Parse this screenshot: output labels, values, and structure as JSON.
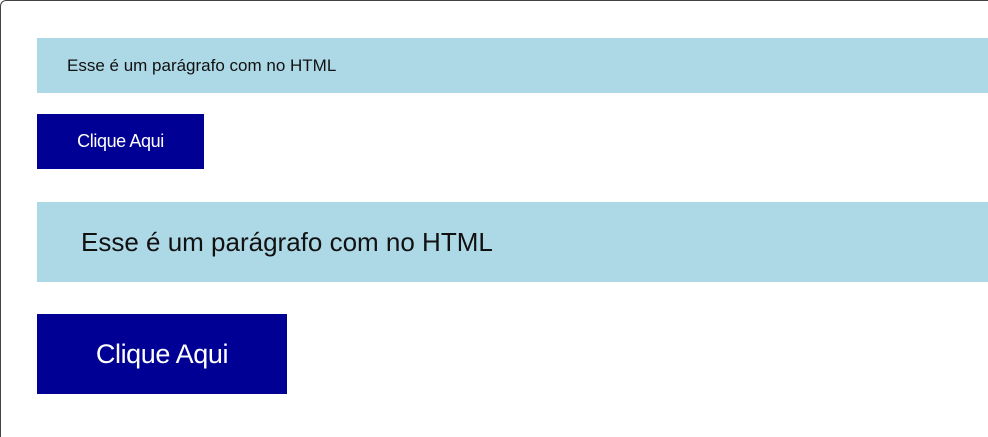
{
  "paragraphs": {
    "small_text": "Esse é um parágrafo com no HTML",
    "large_text": "Esse é um parágrafo com no HTML"
  },
  "buttons": {
    "small_label": "Clique Aqui",
    "large_label": "Clique Aqui"
  },
  "colors": {
    "paragraph_background": "#add8e6",
    "button_background": "#000094",
    "button_text": "#ffffff",
    "paragraph_text": "#111111"
  }
}
